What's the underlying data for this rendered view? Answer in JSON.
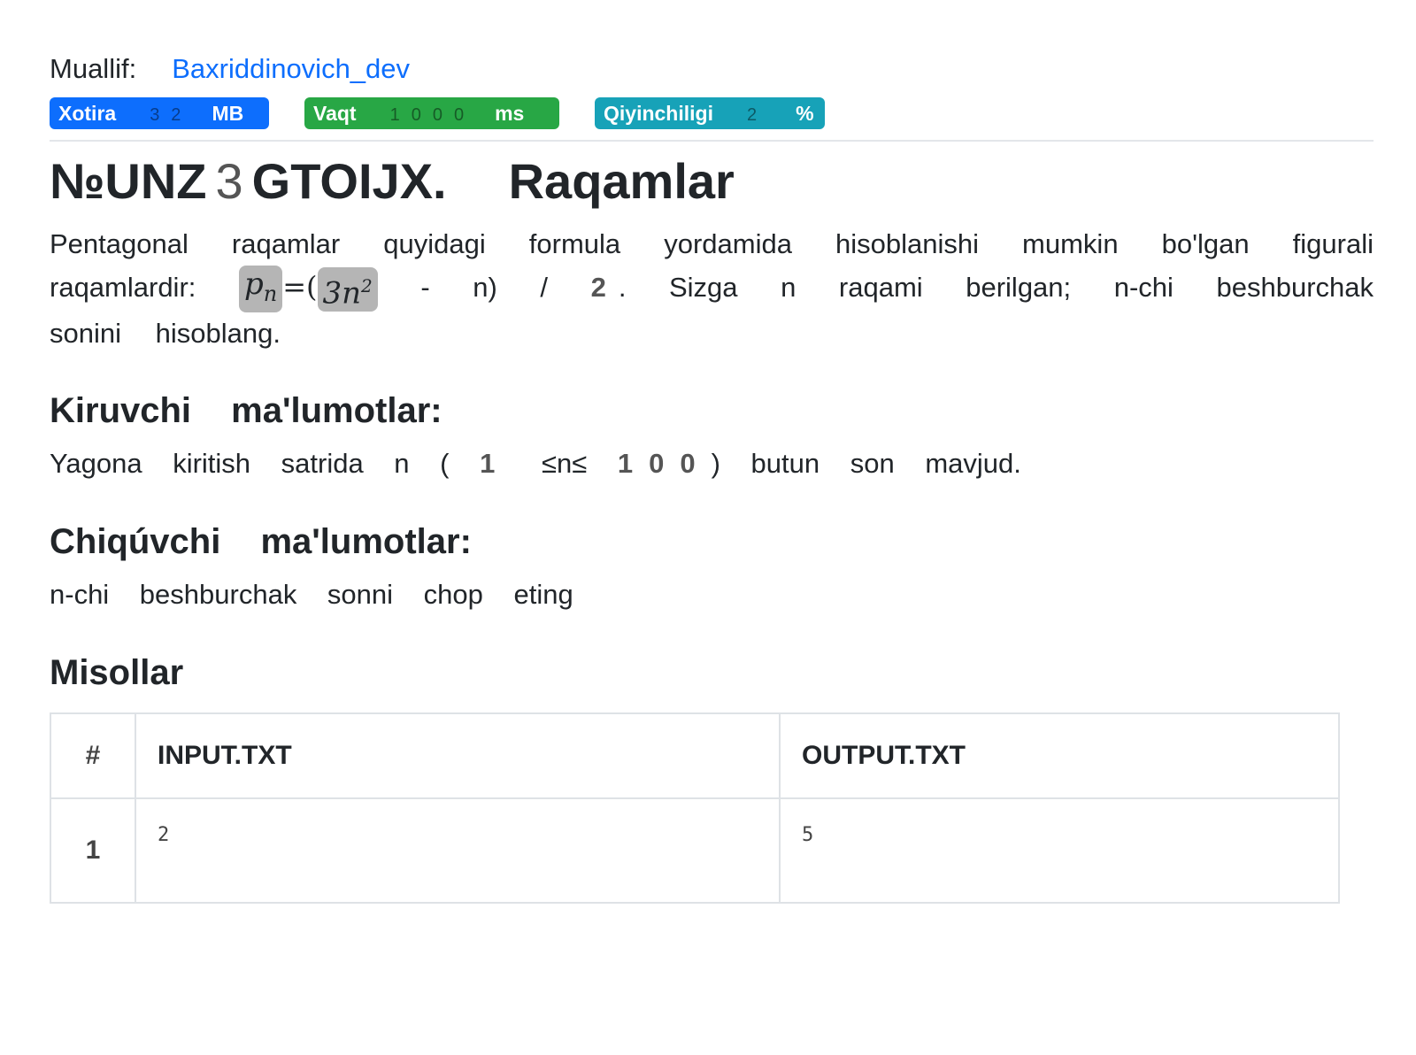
{
  "author": {
    "label": "Muallif:",
    "name": "Baxriddinovich_dev"
  },
  "badges": {
    "memory": {
      "label": "Xotira",
      "value": "32",
      "unit": "MB"
    },
    "time": {
      "label": "Vaqt",
      "value": "1000",
      "unit": "ms"
    },
    "difficulty": {
      "label": "Qiyinchiligi",
      "value": "2",
      "unit": "%"
    }
  },
  "problem": {
    "id_prefix": "№UNZ",
    "id_number": "3",
    "id_suffix": "GTOIJX.",
    "name": "Raqamlar"
  },
  "description": {
    "part1": "Pentagonal raqamlar quyidagi formula yordamida hisoblanishi mumkin bo'lgan figurali raqamlardir:",
    "formula_lhs": "p",
    "formula_lhs_sub": "n",
    "formula_eq": "=(",
    "formula_term": "3n",
    "formula_term_sup": "2",
    "formula_rest": " - n) / ",
    "formula_den": "2",
    "part2": ". Sizga n raqami berilgan; n-chi beshburchak sonini hisoblang."
  },
  "input_section": {
    "heading": "Kiruvchi ma'lumotlar:",
    "text_before": "Yagona kiritish satrida n (",
    "low": "1",
    "cmp": " ≤n≤ ",
    "high": "100",
    "text_after": ") butun son mavjud."
  },
  "output_section": {
    "heading": "Chiqúvchi ma'lumotlar:",
    "text": "n-chi beshburchak sonni chop eting"
  },
  "examples": {
    "heading": "Misollar",
    "columns": [
      "#",
      "INPUT.TXT",
      "OUTPUT.TXT"
    ],
    "rows": [
      {
        "index": "1",
        "input": "2",
        "output": "5"
      }
    ]
  },
  "colors": {
    "link": "#0d6efd",
    "memory_badge": "#0d6efd",
    "time_badge": "#28a745",
    "difficulty_badge": "#17a2b8"
  }
}
